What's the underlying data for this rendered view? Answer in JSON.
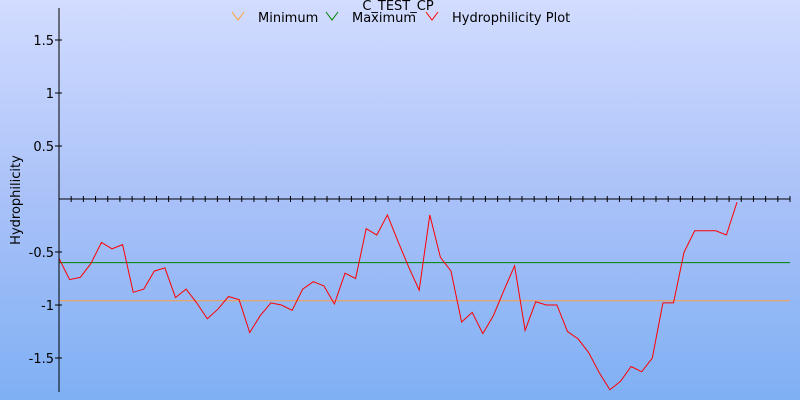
{
  "chart_data": {
    "type": "line",
    "title": "C_TEST_CP",
    "xlabel": "",
    "ylabel": "Hydrophilicity",
    "ylim": [
      -1.8,
      1.8
    ],
    "yticks": [
      {
        "value": 1.5,
        "label": "1.5"
      },
      {
        "value": 1.0,
        "label": "1"
      },
      {
        "value": 0.5,
        "label": "0.5"
      },
      {
        "value": -0.5,
        "label": "-0.5"
      },
      {
        "value": -1.0,
        "label": "-1"
      },
      {
        "value": -1.5,
        "label": "-1.5"
      }
    ],
    "zero_axis_ticks": 60,
    "x": [
      1,
      2,
      3,
      4,
      5,
      6,
      7,
      8,
      9,
      10,
      11,
      12,
      13,
      14,
      15,
      16,
      17,
      18,
      19,
      20,
      21,
      22,
      23,
      24,
      25,
      26,
      27,
      28,
      29,
      30,
      31,
      32,
      33,
      34,
      35,
      36,
      37,
      38,
      39,
      40,
      41,
      42,
      43,
      44,
      45,
      46,
      47,
      48,
      49,
      50,
      51,
      52,
      53,
      54,
      55,
      56,
      57,
      58,
      59,
      60,
      61,
      62,
      63,
      64,
      65,
      66,
      67,
      68,
      69,
      70
    ],
    "legend_position": "top",
    "series": [
      {
        "name": "Minimum",
        "color": "#ffa040",
        "values": [
          -0.96,
          -0.96,
          -0.96,
          -0.96,
          -0.96,
          -0.96,
          -0.96,
          -0.96,
          -0.96,
          -0.96,
          -0.96,
          -0.96,
          -0.96,
          -0.96,
          -0.96,
          -0.96,
          -0.96,
          -0.96,
          -0.96,
          -0.96,
          -0.96,
          -0.96,
          -0.96,
          -0.96,
          -0.96,
          -0.96,
          -0.96,
          -0.96,
          -0.96,
          -0.96,
          -0.96,
          -0.96,
          -0.96,
          -0.96,
          -0.96,
          -0.96,
          -0.96,
          -0.96,
          -0.96,
          -0.96,
          -0.96,
          -0.96,
          -0.96,
          -0.96,
          -0.96,
          -0.96,
          -0.96,
          -0.96,
          -0.96,
          -0.96,
          -0.96,
          -0.96,
          -0.96,
          -0.96,
          -0.96,
          -0.96,
          -0.96,
          -0.96,
          -0.96,
          -0.96,
          -0.96,
          -0.96,
          -0.96,
          -0.96,
          -0.96,
          -0.96,
          -0.96,
          -0.96,
          -0.96,
          -0.96
        ]
      },
      {
        "name": "Maximum",
        "color": "#008000",
        "values": [
          -0.6,
          -0.6,
          -0.6,
          -0.6,
          -0.6,
          -0.6,
          -0.6,
          -0.6,
          -0.6,
          -0.6,
          -0.6,
          -0.6,
          -0.6,
          -0.6,
          -0.6,
          -0.6,
          -0.6,
          -0.6,
          -0.6,
          -0.6,
          -0.6,
          -0.6,
          -0.6,
          -0.6,
          -0.6,
          -0.6,
          -0.6,
          -0.6,
          -0.6,
          -0.6,
          -0.6,
          -0.6,
          -0.6,
          -0.6,
          -0.6,
          -0.6,
          -0.6,
          -0.6,
          -0.6,
          -0.6,
          -0.6,
          -0.6,
          -0.6,
          -0.6,
          -0.6,
          -0.6,
          -0.6,
          -0.6,
          -0.6,
          -0.6,
          -0.6,
          -0.6,
          -0.6,
          -0.6,
          -0.6,
          -0.6,
          -0.6,
          -0.6,
          -0.6,
          -0.6,
          -0.6,
          -0.6,
          -0.6,
          -0.6,
          -0.6,
          -0.6,
          -0.6,
          -0.6,
          -0.6,
          -0.6
        ]
      },
      {
        "name": "Hydrophilicity Plot",
        "color": "#ff0000",
        "values": [
          -0.56,
          -0.76,
          -0.74,
          -0.61,
          -0.41,
          -0.47,
          -0.43,
          -0.88,
          -0.85,
          -0.68,
          -0.65,
          -0.93,
          -0.85,
          -0.98,
          -1.13,
          -1.04,
          -0.92,
          -0.95,
          -1.26,
          -1.1,
          -0.98,
          -1.0,
          -1.05,
          -0.85,
          -0.78,
          -0.82,
          -0.99,
          -0.7,
          -0.75,
          -0.28,
          -0.34,
          -0.15,
          -0.4,
          -0.64,
          -0.86,
          -0.15,
          -0.55,
          -0.68,
          -1.16,
          -1.07,
          -1.27,
          -1.1,
          -0.86,
          -0.63,
          -1.24,
          -0.97,
          -1.0,
          -1.0,
          -1.25,
          -1.32,
          -1.45,
          -1.64,
          -1.8,
          -1.72,
          -1.58,
          -1.63,
          -1.5,
          -0.98,
          -0.98,
          -0.5,
          -0.3,
          -0.3,
          -0.3,
          -0.34,
          -0.03
        ]
      }
    ]
  }
}
